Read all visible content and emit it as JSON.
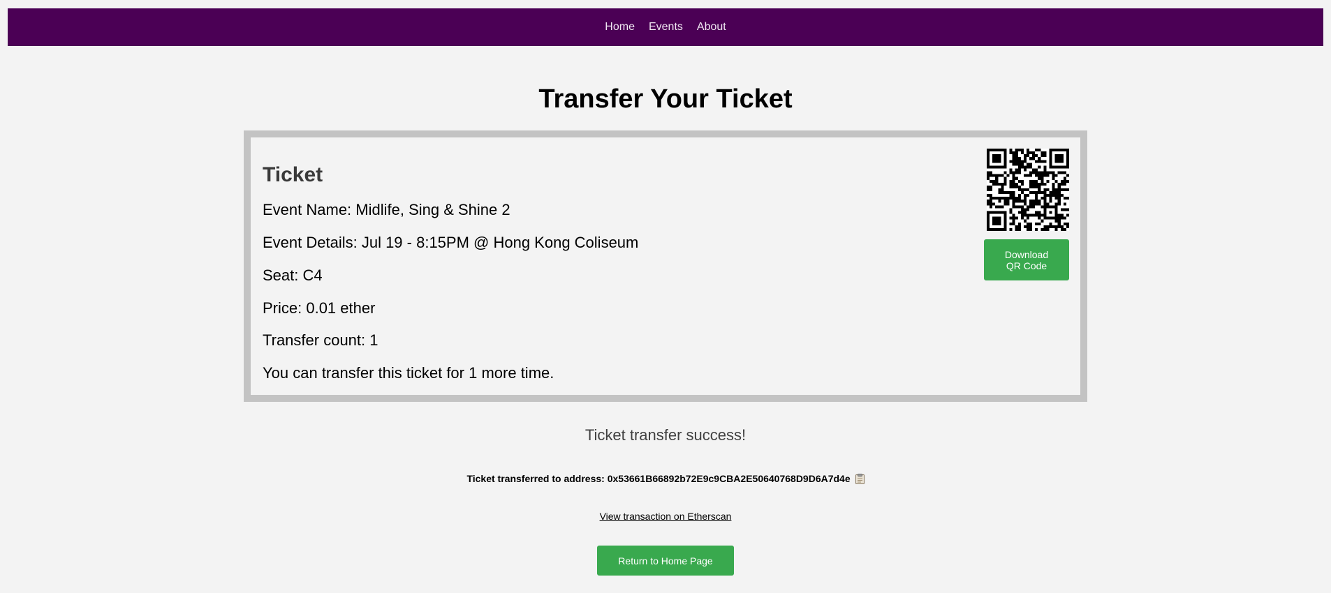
{
  "nav": {
    "items": [
      {
        "label": "Home"
      },
      {
        "label": "Events"
      },
      {
        "label": "About"
      }
    ]
  },
  "page": {
    "title": "Transfer Your Ticket"
  },
  "ticket": {
    "heading": "Ticket",
    "event_name": "Event Name: Midlife, Sing & Shine 2",
    "event_details": "Event Details: Jul 19 - 8:15PM @ Hong Kong Coliseum",
    "seat": "Seat: C4",
    "price": "Price: 0.01 ether",
    "transfer_count": "Transfer count: 1",
    "remaining": "You can transfer this ticket for 1 more time.",
    "qr_icon": "qr-code",
    "download_label": "Download QR Code"
  },
  "result": {
    "success_message": "Ticket transfer success!",
    "address_text": "Ticket transferred to address: 0x53661B66892b72E9c9CBA2E50640768D9D6A7d4e",
    "copy_icon": "clipboard-icon",
    "etherscan_link": "View transaction on Etherscan",
    "home_button": "Return to Home Page"
  },
  "colors": {
    "nav_bg": "#4b0055",
    "accent_green": "#39a94e",
    "card_border": "#c3c3c3",
    "page_bg": "#f3f3f3"
  }
}
